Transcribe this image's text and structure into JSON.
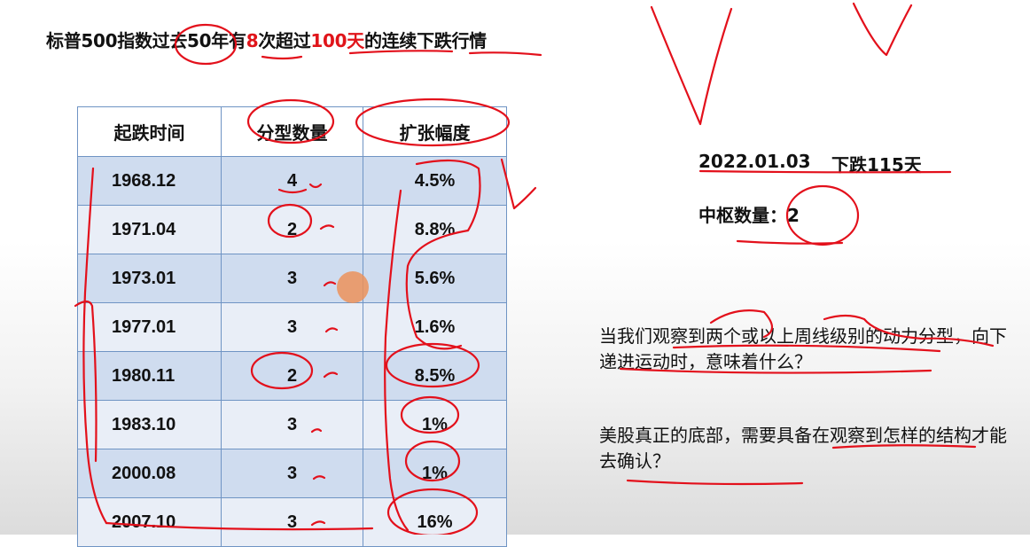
{
  "title": {
    "part1": "标普500指数过去50年有",
    "count": "8",
    "part2": "次超过",
    "days": "100天",
    "part3": "的连续下跌行情"
  },
  "table": {
    "headers": [
      "起跌时间",
      "分型数量",
      "扩张幅度"
    ],
    "rows": [
      {
        "date": "1968.12",
        "count": "4",
        "expansion": "4.5%"
      },
      {
        "date": "1971.04",
        "count": "2",
        "expansion": "8.8%"
      },
      {
        "date": "1973.01",
        "count": "3",
        "expansion": "5.6%"
      },
      {
        "date": "1977.01",
        "count": "3",
        "expansion": "1.6%"
      },
      {
        "date": "1980.11",
        "count": "2",
        "expansion": "8.5%"
      },
      {
        "date": "1983.10",
        "count": "3",
        "expansion": "1%"
      },
      {
        "date": "2000.08",
        "count": "3",
        "expansion": "1%"
      },
      {
        "date": "2007.10",
        "count": "3",
        "expansion": "16%"
      }
    ]
  },
  "info": {
    "date": "2022.01.03",
    "decline": "下跌115天",
    "hub_label": "中枢数量：",
    "hub_value": "2"
  },
  "questions": {
    "q1": "当我们观察到两个或以上周线级别的动力分型，向下递进运动时，意味着什么？",
    "q2": "美股真正的底部，需要具备在观察到怎样的结构才能去确认？"
  },
  "colors": {
    "highlight": "#e0141a",
    "annotation": "#e3101b",
    "table_border": "#6f94c4",
    "row_dark": "#cfdcef",
    "row_light": "#e9eef7"
  }
}
